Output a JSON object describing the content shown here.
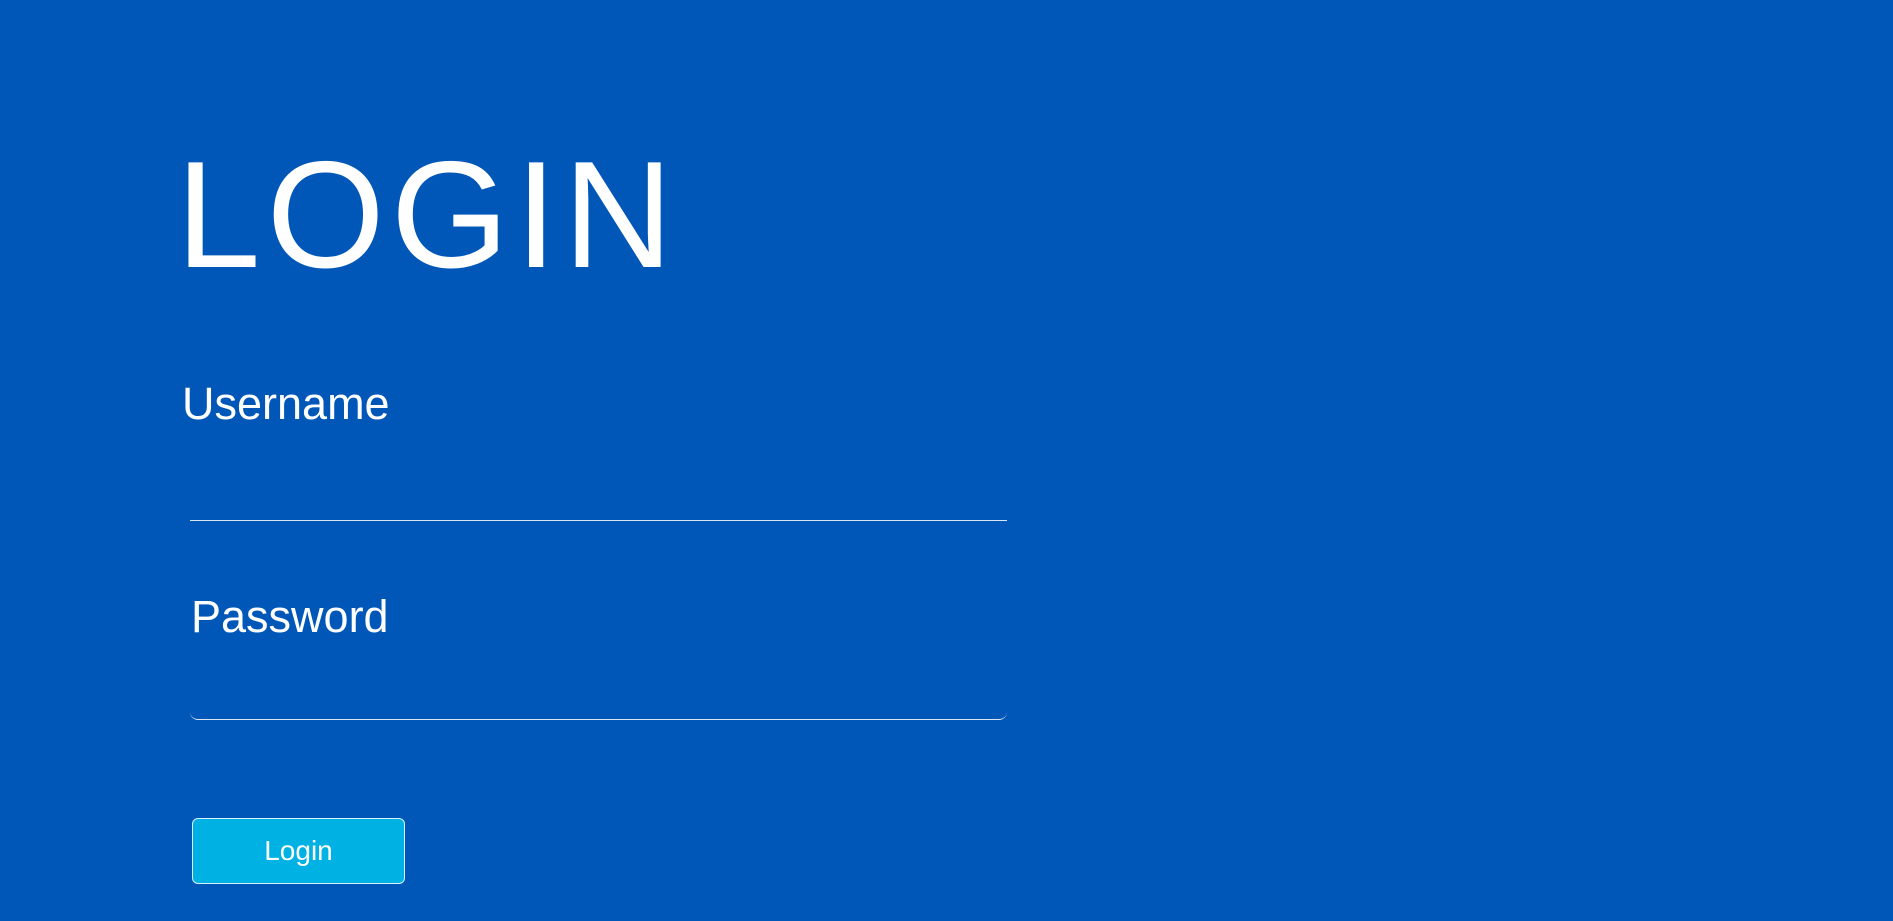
{
  "page": {
    "heading": "LOGIN",
    "background_color": "#0057b8"
  },
  "form": {
    "username": {
      "label": "Username",
      "value": "",
      "placeholder": ""
    },
    "password": {
      "label": "Password",
      "value": "",
      "placeholder": ""
    },
    "submit_label": "Login",
    "submit_color": "#00b2e3"
  }
}
